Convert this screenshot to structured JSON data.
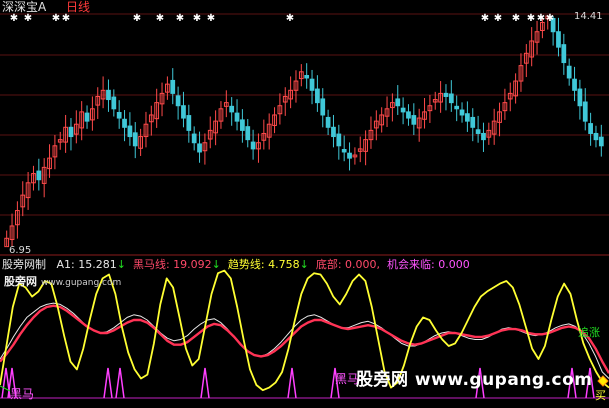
{
  "header": {
    "title": "深深宝A",
    "period": "日线"
  },
  "price_axis": {
    "high_label": "14.41",
    "low_label": "6.95"
  },
  "indicator_bar": {
    "name": "股旁网制",
    "a1": {
      "label": "A1:",
      "value": "15.281",
      "arrow": "↓"
    },
    "heima": {
      "label": "黑马线:",
      "value": "19.092",
      "arrow": "↓"
    },
    "trend": {
      "label": "趋势线:",
      "value": "4.758",
      "arrow": "↓"
    },
    "bottom": {
      "label": "底部:",
      "value": "0.000,"
    },
    "chance": {
      "label": "机会来临:",
      "value": "0.000"
    }
  },
  "annotations": {
    "watermark_small": "股旁网",
    "watermark_small_url": "www.gupang.com",
    "heima_left": "黑马",
    "heima_mid": "黑马",
    "zhuizhang": "追涨",
    "buy": "买",
    "watermark_big": "股旁网 www.gupang.com"
  },
  "colors": {
    "up": "#ff4a4a",
    "down": "#40c8d8",
    "yellow": "#ffff33",
    "red": "#ff3355",
    "white": "#e8e8e8",
    "magenta": "#ff40ff",
    "green": "#22dd22"
  },
  "chart_data": [
    {
      "type": "candlestick",
      "title": "深深宝A 日线",
      "ylim": [
        6.95,
        14.41
      ],
      "high": 14.41,
      "low": 6.95,
      "closes": [
        7.2,
        7.6,
        8.1,
        8.6,
        9.0,
        9.3,
        9.1,
        9.5,
        9.8,
        10.2,
        10.4,
        10.8,
        10.5,
        10.9,
        11.3,
        11.0,
        11.4,
        11.8,
        12.0,
        11.7,
        11.4,
        11.1,
        10.8,
        10.5,
        10.2,
        10.5,
        10.9,
        11.2,
        11.6,
        11.9,
        12.2,
        11.9,
        11.5,
        11.1,
        10.7,
        10.3,
        10.0,
        10.3,
        10.7,
        11.0,
        11.4,
        11.6,
        11.3,
        11.0,
        10.7,
        10.4,
        10.1,
        10.3,
        10.6,
        10.9,
        11.2,
        11.5,
        11.8,
        12.0,
        12.3,
        12.6,
        12.4,
        12.0,
        11.6,
        11.2,
        10.8,
        10.5,
        10.2,
        10.0,
        9.8,
        9.9,
        10.1,
        10.4,
        10.7,
        11.0,
        11.2,
        11.4,
        11.6,
        11.5,
        11.3,
        11.1,
        10.9,
        11.1,
        11.3,
        11.5,
        11.7,
        11.9,
        11.8,
        11.6,
        11.4,
        11.2,
        11.0,
        10.8,
        10.6,
        10.4,
        10.7,
        11.0,
        11.3,
        11.6,
        11.9,
        12.3,
        12.8,
        13.2,
        13.6,
        13.9,
        14.2,
        14.41,
        13.9,
        13.4,
        12.9,
        12.4,
        12.0,
        11.5,
        11.0,
        10.6,
        10.4,
        10.2
      ],
      "diamond_markers": [
        "top"
      ],
      "note": "K-line (candlestick) main chart; red = up days, cyan = down days"
    },
    {
      "type": "line",
      "title": "股旁网制",
      "series": [
        {
          "name": "A1",
          "color": "#e8e8e8",
          "last": 15.281,
          "values": [
            30,
            38,
            47,
            55,
            62,
            66,
            70,
            72,
            73,
            72,
            69,
            65,
            60,
            55,
            52,
            50,
            51,
            54,
            58,
            62,
            64,
            63,
            60,
            55,
            50,
            46,
            44,
            45,
            48,
            53,
            57,
            60,
            61,
            58,
            53,
            47,
            41,
            36,
            33,
            32,
            34,
            38,
            43,
            49,
            55,
            60,
            63,
            64,
            62,
            59,
            56,
            54,
            54,
            56,
            58,
            59,
            57,
            54,
            50,
            46,
            42,
            40,
            40,
            42,
            45,
            48,
            50,
            51,
            50,
            48,
            46,
            45,
            45,
            47,
            50,
            53,
            54,
            53,
            51,
            49,
            48,
            49,
            51,
            54,
            56,
            57,
            55,
            50,
            42,
            32,
            20,
            15
          ]
        },
        {
          "name": "黑马线",
          "color": "#ff3355",
          "last": 19.092,
          "values": [
            28,
            34,
            41,
            49,
            56,
            62,
            67,
            70,
            71,
            70,
            67,
            63,
            59,
            55,
            52,
            50,
            50,
            52,
            55,
            58,
            60,
            60,
            58,
            54,
            49,
            44,
            41,
            41,
            43,
            47,
            51,
            55,
            57,
            56,
            52,
            47,
            41,
            36,
            33,
            32,
            33,
            36,
            40,
            45,
            50,
            55,
            58,
            60,
            60,
            58,
            56,
            54,
            53,
            54,
            55,
            56,
            55,
            53,
            50,
            47,
            44,
            42,
            41,
            42,
            44,
            46,
            48,
            50,
            50,
            49,
            48,
            47,
            47,
            48,
            50,
            52,
            53,
            53,
            52,
            50,
            49,
            49,
            50,
            52,
            54,
            55,
            54,
            51,
            46,
            38,
            28,
            19
          ]
        },
        {
          "name": "趋势线",
          "color": "#ffff33",
          "last": 4.758,
          "values": [
            10,
            40,
            70,
            88,
            85,
            78,
            82,
            90,
            88,
            70,
            48,
            28,
            22,
            38,
            60,
            80,
            92,
            95,
            80,
            55,
            35,
            22,
            15,
            18,
            42,
            72,
            92,
            85,
            62,
            38,
            25,
            30,
            55,
            80,
            96,
            98,
            92,
            70,
            45,
            22,
            10,
            6,
            8,
            12,
            20,
            38,
            60,
            80,
            92,
            96,
            95,
            88,
            78,
            72,
            80,
            90,
            95,
            90,
            70,
            45,
            20,
            8,
            12,
            25,
            42,
            55,
            62,
            60,
            52,
            45,
            40,
            42,
            50,
            60,
            70,
            78,
            82,
            85,
            88,
            90,
            85,
            72,
            55,
            38,
            30,
            40,
            60,
            78,
            88,
            80,
            60,
            42,
            30,
            20,
            12,
            8
          ]
        },
        {
          "name": "底部",
          "color": "#ff40ff",
          "last": 0.0
        }
      ],
      "ylim": [
        0,
        100
      ]
    }
  ]
}
